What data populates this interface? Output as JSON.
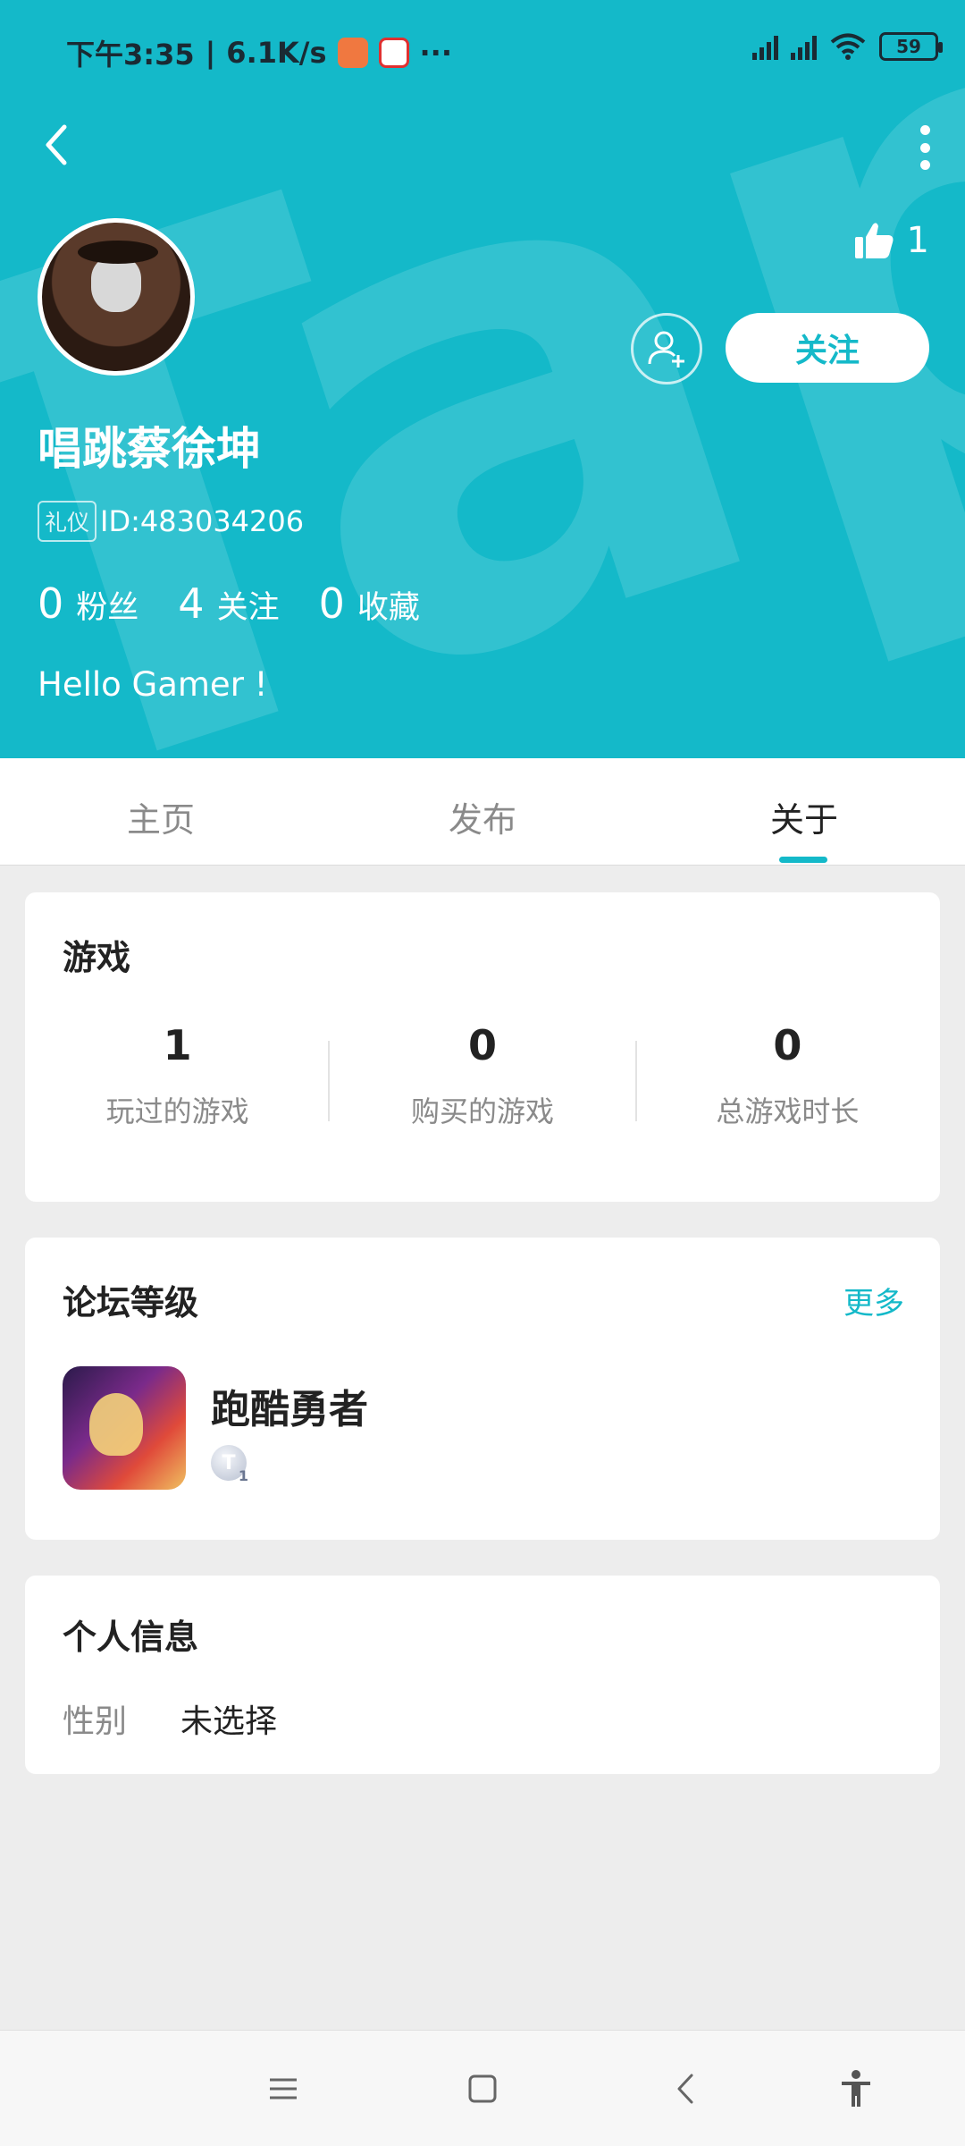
{
  "status_bar": {
    "time": "下午3:35",
    "speed": "6.1K/s",
    "more": "···",
    "battery": "59"
  },
  "header": {
    "like_count": "1",
    "follow_label": "关注",
    "username": "唱跳蔡徐坤",
    "badge": "礼仪",
    "user_id": "ID:483034206",
    "stats": [
      {
        "num": "0",
        "label": "粉丝"
      },
      {
        "num": "4",
        "label": "关注"
      },
      {
        "num": "0",
        "label": "收藏"
      }
    ],
    "bio": "Hello Gamer !"
  },
  "tabs": [
    {
      "label": "主页"
    },
    {
      "label": "发布"
    },
    {
      "label": "关于",
      "active": true
    }
  ],
  "games": {
    "title": "游戏",
    "stats": [
      {
        "num": "1",
        "label": "玩过的游戏"
      },
      {
        "num": "0",
        "label": "购买的游戏"
      },
      {
        "num": "0",
        "label": "总游戏时长"
      }
    ]
  },
  "forum": {
    "title": "论坛等级",
    "more": "更多",
    "game_name": "跑酷勇者",
    "level_letter": "T",
    "level_num": "1"
  },
  "personal": {
    "title": "个人信息",
    "gender_label": "性别",
    "gender_value": "未选择"
  },
  "colors": {
    "accent": "#14b9c9",
    "background": "#ededed"
  },
  "icons": {
    "back": "back-arrow-icon",
    "more": "more-vertical-icon",
    "like": "thumbs-up-icon",
    "add_friend": "add-friend-icon",
    "nav": [
      "menu-icon",
      "home-icon",
      "back-icon",
      "accessibility-icon"
    ]
  }
}
